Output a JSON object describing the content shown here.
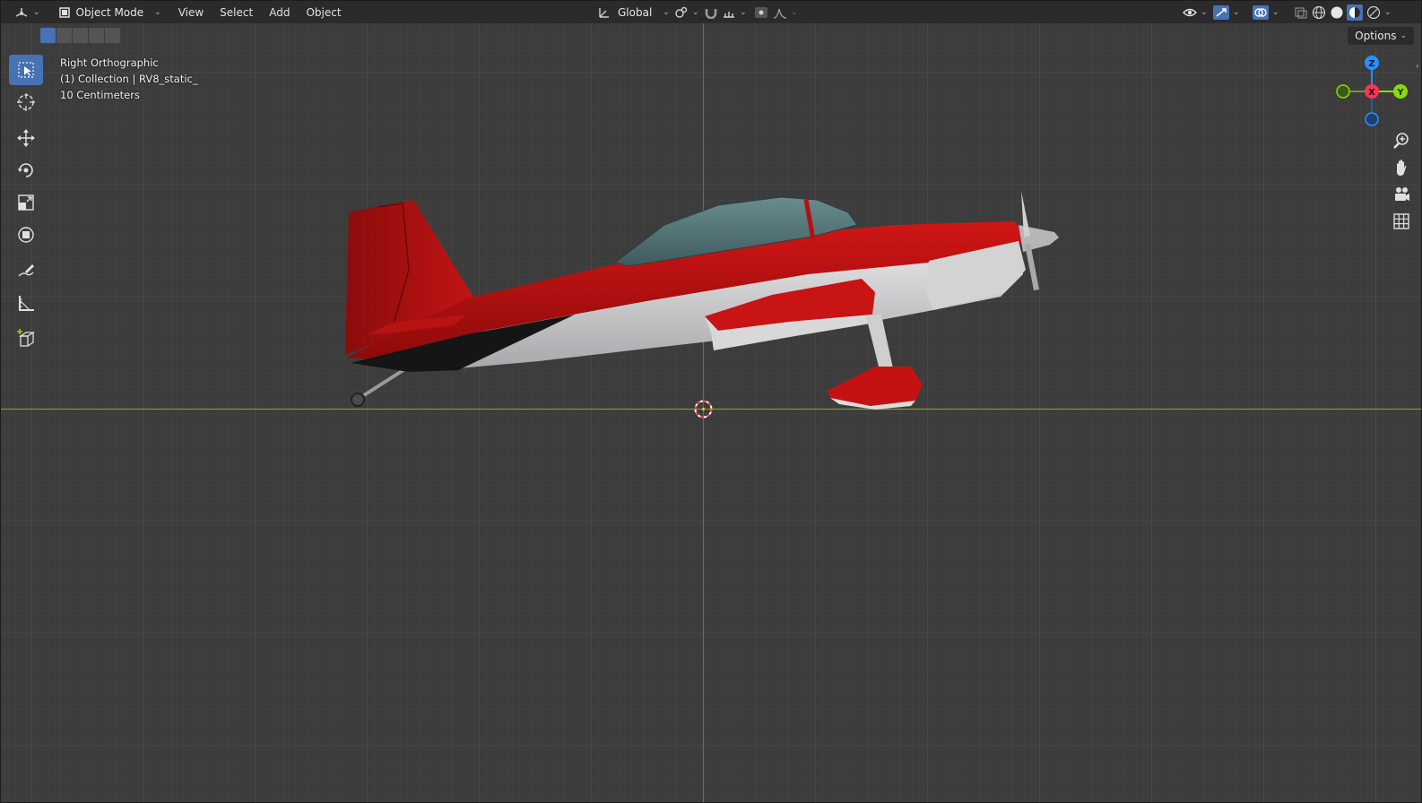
{
  "header": {
    "editor_type_icon": "3d-viewport-icon",
    "mode_label": "Object Mode",
    "menu": [
      "View",
      "Select",
      "Add",
      "Object"
    ],
    "transform_orientation": "Global"
  },
  "viewport": {
    "options_label": "Options",
    "overlay_lines": [
      "Right Orthographic",
      "(1) Collection | RV8_static_",
      "10 Centimeters"
    ],
    "axes": {
      "z": "Z",
      "x": "X",
      "y": "Y"
    }
  },
  "toolbar": {
    "tools": [
      "select-box-icon",
      "cursor-icon",
      "move-icon",
      "rotate-icon",
      "scale-icon",
      "transform-icon",
      "annotate-icon",
      "measure-icon",
      "add-cube-icon"
    ]
  },
  "colors": {
    "accent": "#4772b3",
    "axis_x": "#ff3352",
    "axis_y": "#8bdc00",
    "axis_z": "#2890ff",
    "grid_bg": "#3c3c3c"
  }
}
